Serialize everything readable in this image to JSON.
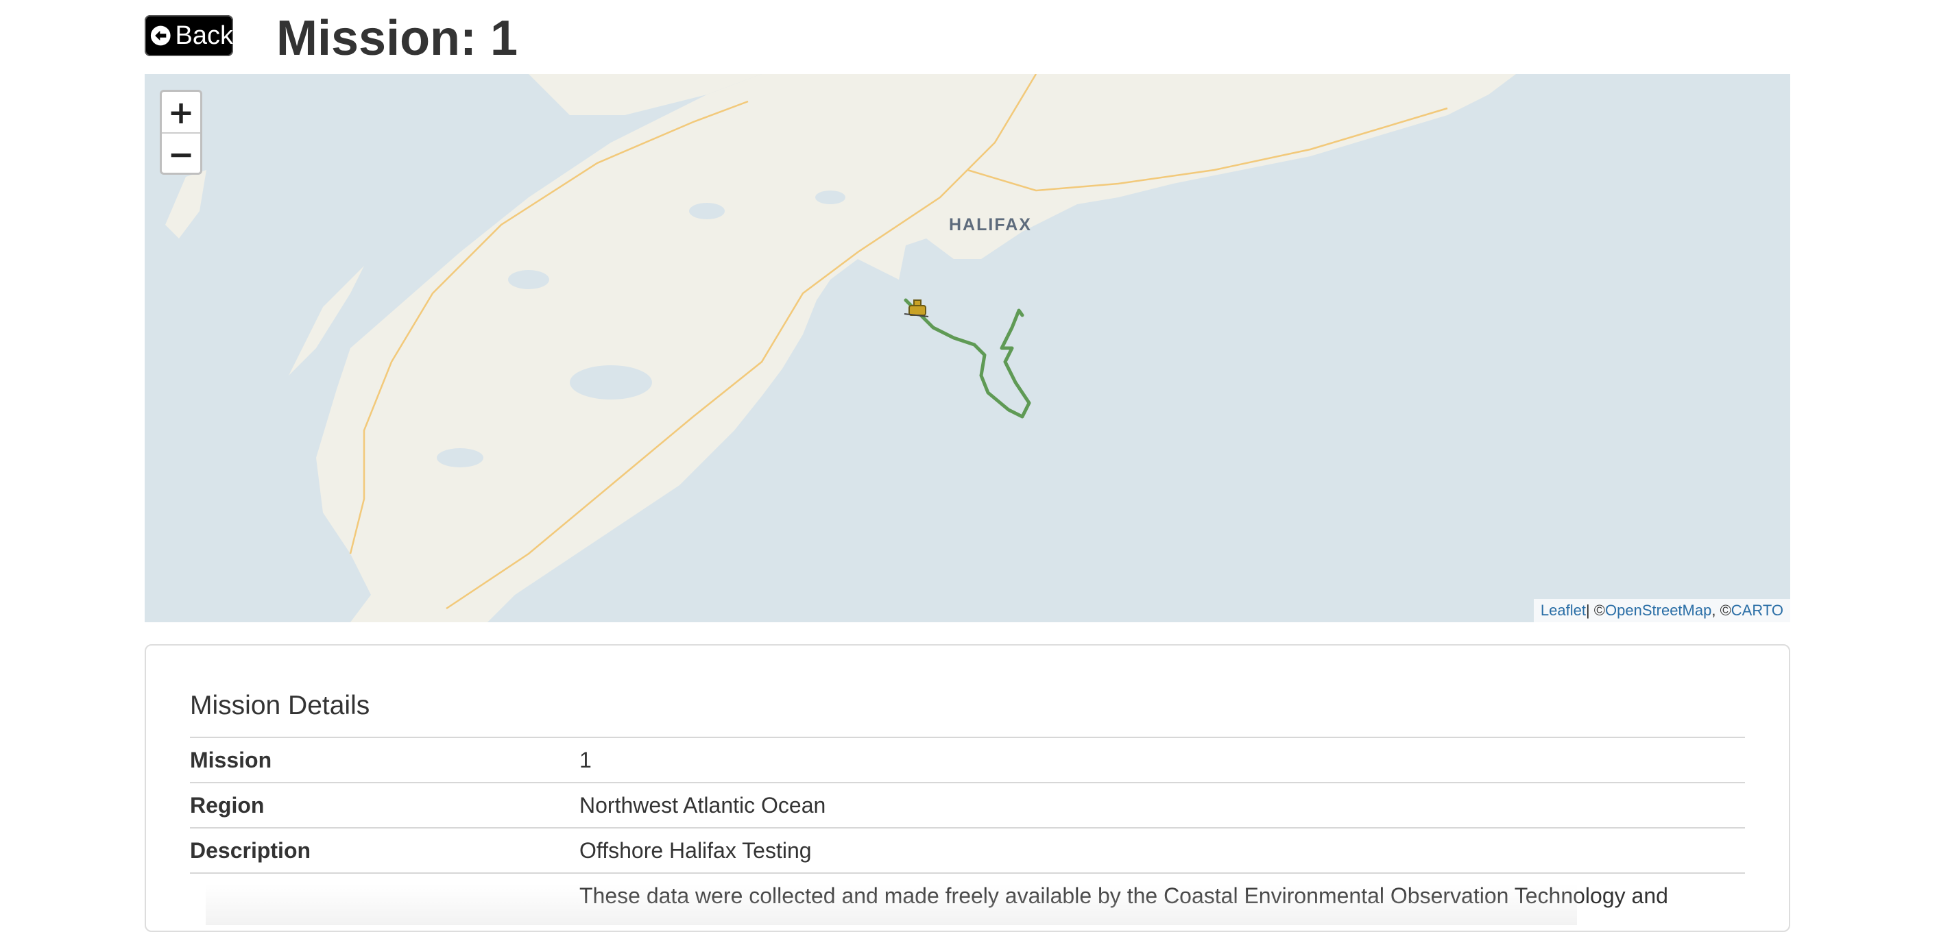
{
  "header": {
    "back_label": "Back",
    "title": "Mission: 1"
  },
  "map": {
    "zoom_in_label": "+",
    "zoom_out_label": "−",
    "city_label": "HALIFAX",
    "attribution": {
      "leaflet": "Leaflet",
      "separator": " | ©",
      "osm": "OpenStreetMap",
      "comma": ", ©",
      "carto": "CARTO"
    },
    "colors": {
      "water": "#d9e4ea",
      "land": "#f1f0e8",
      "track": "#5f9a55",
      "road": "#f2c97a"
    },
    "marker_icon": "glider-icon"
  },
  "details": {
    "heading": "Mission Details",
    "rows": [
      {
        "key": "Mission",
        "value": "1"
      },
      {
        "key": "Region",
        "value": "Northwest Atlantic Ocean"
      },
      {
        "key": "Description",
        "value": "Offshore Halifax Testing"
      },
      {
        "key": "",
        "value": "These data were collected and made freely available by the Coastal Environmental Observation Technology and"
      }
    ]
  }
}
